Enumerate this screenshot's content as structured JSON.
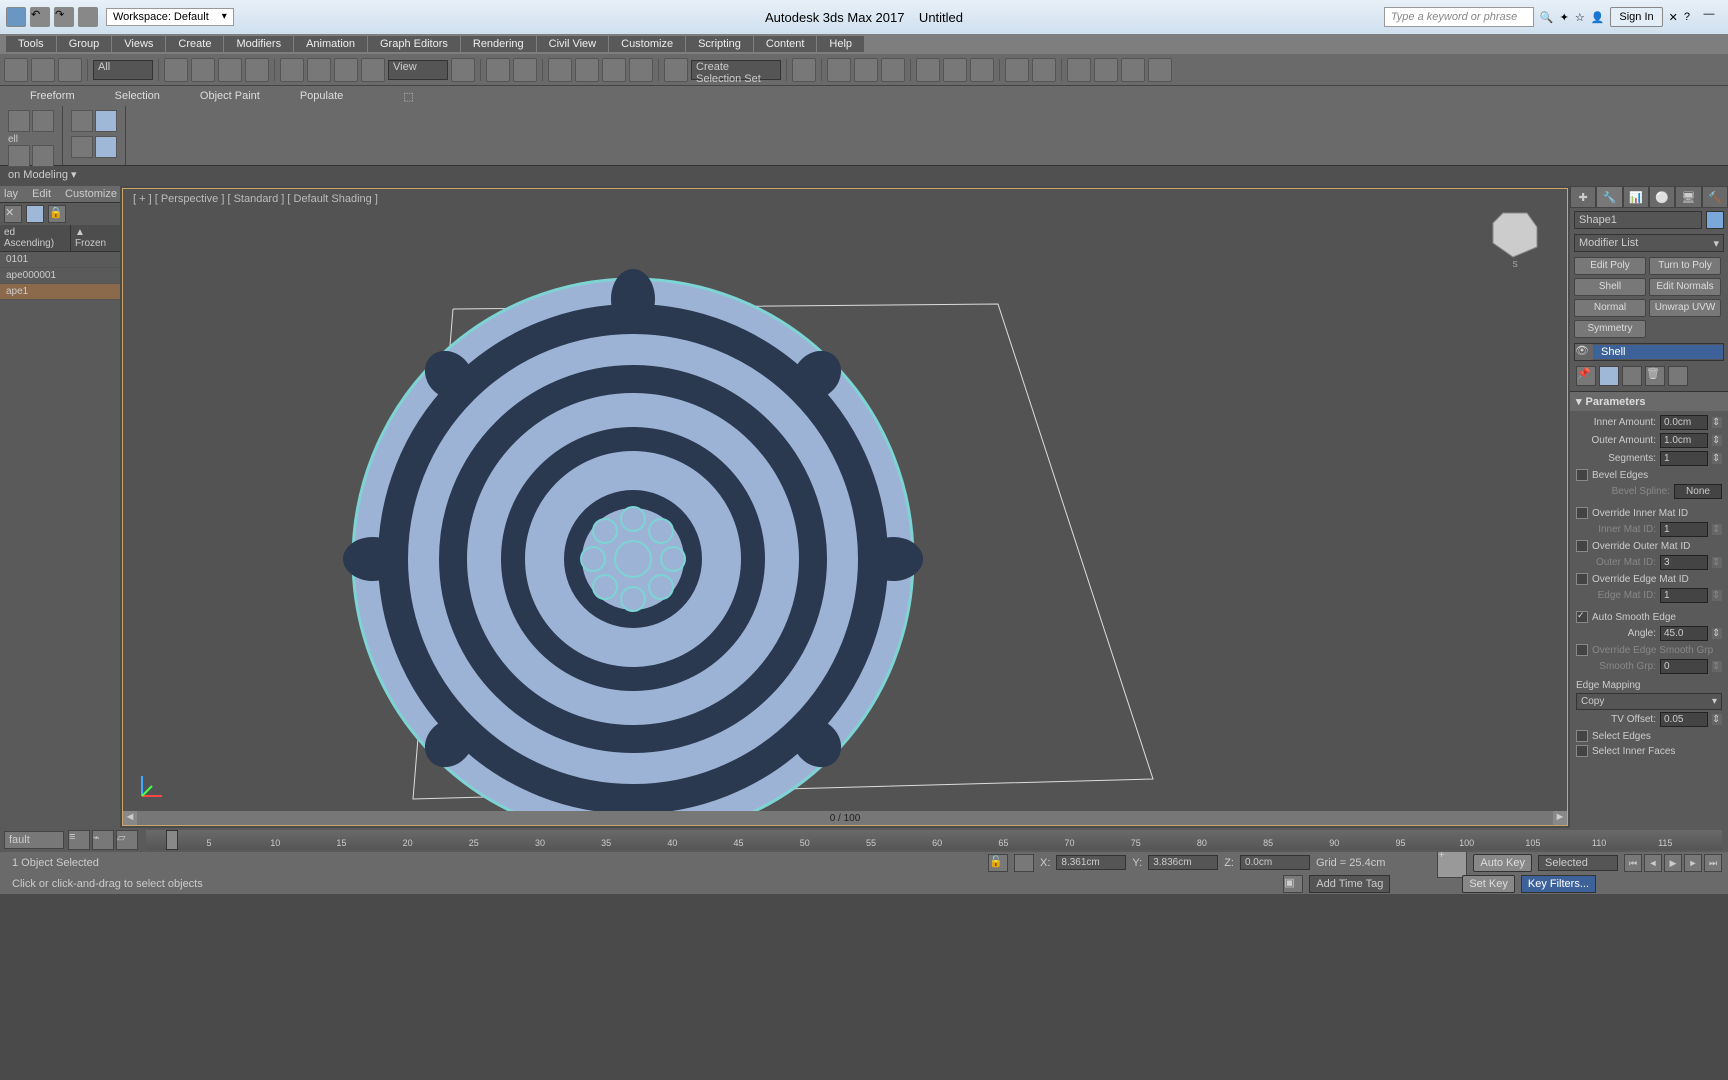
{
  "titlebar": {
    "workspace": "Workspace: Default",
    "app": "Autodesk 3ds Max 2017",
    "doc": "Untitled",
    "search_placeholder": "Type a keyword or phrase",
    "signin": "Sign In"
  },
  "menu": [
    "Tools",
    "Group",
    "Views",
    "Create",
    "Modifiers",
    "Animation",
    "Graph Editors",
    "Rendering",
    "Civil View",
    "Customize",
    "Scripting",
    "Content",
    "Help"
  ],
  "maintb": {
    "filter_label": "All",
    "view_label": "View",
    "named_sel": "Create Selection Set"
  },
  "ribbon_tabs": [
    "Freeform",
    "Selection",
    "Object Paint",
    "Populate"
  ],
  "modeling_label": "on Modeling",
  "scene": {
    "menu": [
      "lay",
      "Edit",
      "Customize"
    ],
    "col1": "ed Ascending)",
    "col2": "▲ Frozen",
    "items": [
      "0101",
      "ape000001",
      "ape1"
    ]
  },
  "viewport": {
    "label": "[ + ] [ Perspective ] [ Standard ] [ Default Shading ]",
    "scroll": "0 / 100"
  },
  "cmdpanel": {
    "object_name": "Shape1",
    "modifier_list": "Modifier List",
    "mod_buttons": [
      "Edit Poly",
      "Turn to Poly",
      "Shell",
      "Edit Normals",
      "Normal",
      "Unwrap UVW",
      "Symmetry"
    ],
    "stack_item": "Shell",
    "rollup": "Parameters",
    "params": {
      "inner_amount_lbl": "Inner Amount:",
      "inner_amount": "0.0cm",
      "outer_amount_lbl": "Outer Amount:",
      "outer_amount": "1.0cm",
      "segments_lbl": "Segments:",
      "segments": "1",
      "bevel_edges": "Bevel Edges",
      "bevel_spline_lbl": "Bevel Spline:",
      "bevel_spline": "None",
      "override_inner": "Override Inner Mat ID",
      "inner_mat_lbl": "Inner Mat ID:",
      "inner_mat": "1",
      "override_outer": "Override Outer Mat ID",
      "outer_mat_lbl": "Outer Mat ID:",
      "outer_mat": "3",
      "override_edge": "Override Edge Mat ID",
      "edge_mat_lbl": "Edge Mat ID:",
      "edge_mat": "1",
      "auto_smooth": "Auto Smooth Edge",
      "angle_lbl": "Angle:",
      "angle": "45.0",
      "override_edge_smooth": "Override Edge Smooth Grp",
      "smooth_grp_lbl": "Smooth Grp:",
      "smooth_grp": "0",
      "edge_mapping": "Edge Mapping",
      "copy": "Copy",
      "tv_offset_lbl": "TV Offset:",
      "tv_offset": "0.05",
      "select_edges": "Select Edges",
      "select_inner": "Select Inner Faces"
    }
  },
  "timeline": {
    "default": "fault",
    "ticks": [
      "5",
      "10",
      "15",
      "20",
      "25",
      "30",
      "35",
      "40",
      "45",
      "50",
      "55",
      "60",
      "65",
      "70",
      "75",
      "80",
      "85",
      "90",
      "95",
      "100",
      "105",
      "110",
      "115"
    ]
  },
  "status": {
    "selected": "1 Object Selected",
    "prompt": "Click or click-and-drag to select objects",
    "x_lbl": "X:",
    "x": "8.361cm",
    "y_lbl": "Y:",
    "y": "3.836cm",
    "z_lbl": "Z:",
    "z": "0.0cm",
    "grid": "Grid = 25.4cm",
    "autokey": "Auto Key",
    "setkey": "Set Key",
    "selected_drop": "Selected",
    "keyfilters": "Key Filters...",
    "addtag": "Add Time Tag"
  }
}
